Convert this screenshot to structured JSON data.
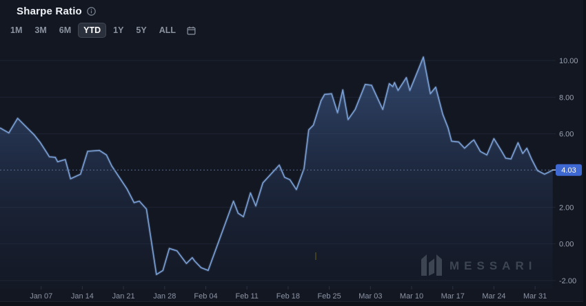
{
  "header": {
    "title": "Sharpe Ratio",
    "info_icon": "info-circle-icon"
  },
  "ranges": {
    "options": [
      "1M",
      "3M",
      "6M",
      "YTD",
      "1Y",
      "5Y",
      "ALL"
    ],
    "selected": "YTD",
    "calendar_icon": "calendar-icon"
  },
  "watermark": {
    "label": "MESSARI",
    "logo": "messari-logo"
  },
  "colors": {
    "background": "#131722",
    "line": "#7ba0d6",
    "area_top": "#557dbe",
    "grid": "#1e2432",
    "axis_label": "#99a2b3",
    "dotted_line": "#5b6e91",
    "badge_bg": "#3e69d2",
    "badge_text": "#ffffff",
    "selected_range_bg": "#2a303c",
    "watermark": "#3d4452"
  },
  "chart_data": {
    "type": "area",
    "title": "Sharpe Ratio (YTD)",
    "x_domain": [
      0,
      94.5
    ],
    "ylim": [
      -2,
      10
    ],
    "grid": true,
    "legend": "none",
    "y_ticks": [
      {
        "label": "10.00",
        "v": 10
      },
      {
        "label": "8.00",
        "v": 8
      },
      {
        "label": "6.00",
        "v": 6
      },
      {
        "label": "2.00",
        "v": 2
      },
      {
        "label": "0.00",
        "v": 0
      },
      {
        "label": "-2.00",
        "v": -2
      }
    ],
    "x_ticks": [
      {
        "label": "Jan 07",
        "d": 7
      },
      {
        "label": "Jan 14",
        "d": 14
      },
      {
        "label": "Jan 21",
        "d": 21
      },
      {
        "label": "Jan 28",
        "d": 28
      },
      {
        "label": "Feb 04",
        "d": 35
      },
      {
        "label": "Feb 11",
        "d": 42
      },
      {
        "label": "Feb 18",
        "d": 49
      },
      {
        "label": "Feb 25",
        "d": 56
      },
      {
        "label": "Mar 03",
        "d": 63
      },
      {
        "label": "Mar 10",
        "d": 70
      },
      {
        "label": "Mar 17",
        "d": 77
      },
      {
        "label": "Mar 24",
        "d": 84
      },
      {
        "label": "Mar 31",
        "d": 91
      }
    ],
    "current_value": {
      "label": "4.03",
      "value": 4.03
    },
    "points": [
      [
        0,
        6.33
      ],
      [
        1.5,
        6.05
      ],
      [
        3,
        6.85
      ],
      [
        4.7,
        6.3
      ],
      [
        5.8,
        5.95
      ],
      [
        6.8,
        5.55
      ],
      [
        7.9,
        5.0
      ],
      [
        8.4,
        4.75
      ],
      [
        9.4,
        4.72
      ],
      [
        9.8,
        4.48
      ],
      [
        11.1,
        4.6
      ],
      [
        12,
        3.55
      ],
      [
        13.7,
        3.8
      ],
      [
        14.9,
        5.05
      ],
      [
        16.9,
        5.1
      ],
      [
        18.1,
        4.85
      ],
      [
        19,
        4.25
      ],
      [
        21.6,
        3.0
      ],
      [
        22.8,
        2.25
      ],
      [
        23.7,
        2.33
      ],
      [
        24.9,
        1.9
      ],
      [
        26.6,
        -1.67
      ],
      [
        27.7,
        -1.45
      ],
      [
        28.8,
        -0.25
      ],
      [
        30.1,
        -0.38
      ],
      [
        31.7,
        -1.07
      ],
      [
        32.7,
        -0.75
      ],
      [
        33.1,
        -0.93
      ],
      [
        34.2,
        -1.3
      ],
      [
        35.4,
        -1.45
      ],
      [
        39.7,
        2.33
      ],
      [
        40.5,
        1.67
      ],
      [
        41.4,
        1.48
      ],
      [
        42.6,
        2.78
      ],
      [
        43.5,
        2.07
      ],
      [
        44.7,
        3.33
      ],
      [
        47.5,
        4.3
      ],
      [
        48.4,
        3.63
      ],
      [
        49.3,
        3.5
      ],
      [
        50.4,
        2.96
      ],
      [
        51.7,
        4.11
      ],
      [
        52.5,
        6.22
      ],
      [
        53.3,
        6.48
      ],
      [
        54.6,
        7.81
      ],
      [
        55.2,
        8.15
      ],
      [
        56.4,
        8.19
      ],
      [
        57.4,
        7.15
      ],
      [
        58.3,
        8.4
      ],
      [
        59.2,
        6.78
      ],
      [
        60.4,
        7.33
      ],
      [
        62.1,
        8.7
      ],
      [
        63.2,
        8.65
      ],
      [
        64.2,
        7.95
      ],
      [
        65.1,
        7.33
      ],
      [
        66.2,
        8.74
      ],
      [
        66.8,
        8.58
      ],
      [
        67.1,
        8.8
      ],
      [
        67.7,
        8.37
      ],
      [
        69.1,
        9.07
      ],
      [
        69.7,
        8.37
      ],
      [
        72,
        10.19
      ],
      [
        73.2,
        8.19
      ],
      [
        74.1,
        8.55
      ],
      [
        75.3,
        7.07
      ],
      [
        76.2,
        6.33
      ],
      [
        76.8,
        5.6
      ],
      [
        78,
        5.56
      ],
      [
        79,
        5.22
      ],
      [
        80.2,
        5.58
      ],
      [
        80.6,
        5.67
      ],
      [
        81.7,
        5.04
      ],
      [
        82.8,
        4.85
      ],
      [
        84,
        5.74
      ],
      [
        85.2,
        5.11
      ],
      [
        86,
        4.67
      ],
      [
        86.9,
        4.63
      ],
      [
        88.1,
        5.52
      ],
      [
        88.9,
        4.93
      ],
      [
        89.6,
        5.22
      ],
      [
        90.4,
        4.63
      ],
      [
        91.4,
        4.0
      ],
      [
        92.6,
        3.8
      ],
      [
        93.2,
        3.89
      ],
      [
        94,
        4.03
      ]
    ]
  }
}
